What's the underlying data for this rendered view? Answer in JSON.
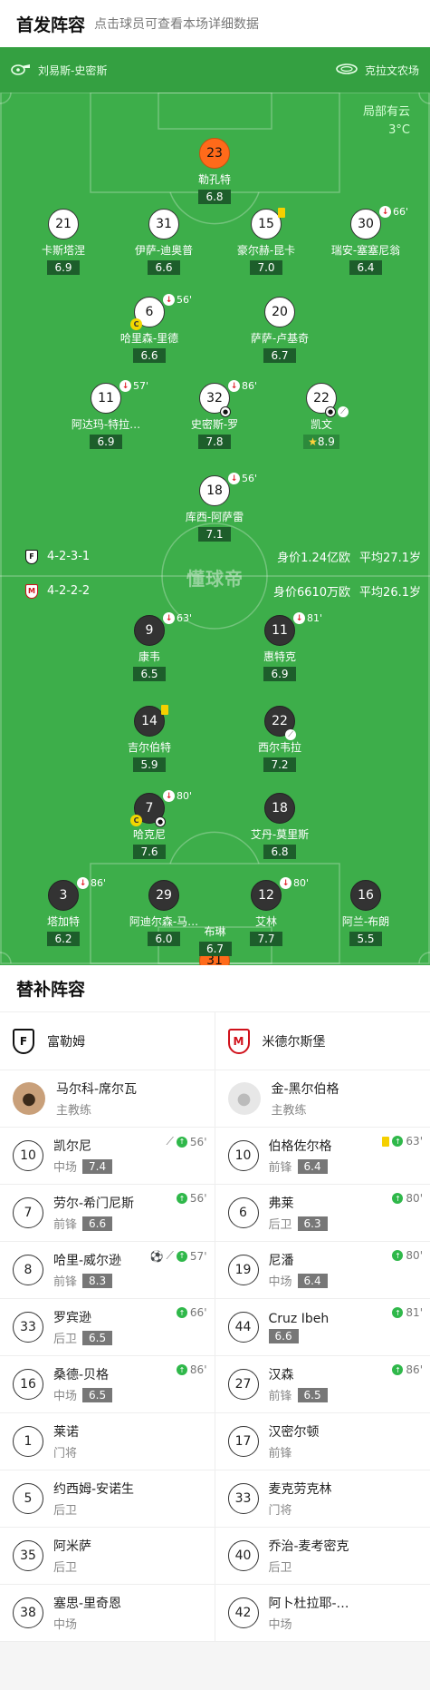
{
  "header": {
    "title": "首发阵容",
    "subtitle": "点击球员可查看本场详细数据"
  },
  "referee": {
    "name": "刘易斯-史密斯"
  },
  "venue": {
    "name": "克拉文农场"
  },
  "weather": {
    "condition": "局部有云",
    "temp": "3°C"
  },
  "home": {
    "formation": "4-2-3-1",
    "value_text": "身价1.24亿欧",
    "age_text": "平均27.1岁",
    "players": [
      {
        "num": "23",
        "name": "勒孔特",
        "rating": "6.8"
      },
      {
        "num": "21",
        "name": "卡斯塔涅",
        "rating": "6.9"
      },
      {
        "num": "31",
        "name": "伊萨-迪奥普",
        "rating": "6.6"
      },
      {
        "num": "15",
        "name": "豪尔赫-昆卡",
        "rating": "7.0"
      },
      {
        "num": "30",
        "name": "瑞安-塞塞尼翁",
        "rating": "6.4",
        "sub": "66'"
      },
      {
        "num": "6",
        "name": "哈里森-里德",
        "rating": "6.6",
        "sub": "56'"
      },
      {
        "num": "20",
        "name": "萨萨-卢基奇",
        "rating": "6.7"
      },
      {
        "num": "11",
        "name": "阿达玛-特拉…",
        "rating": "6.9",
        "sub": "57'"
      },
      {
        "num": "32",
        "name": "史密斯-罗",
        "rating": "7.8",
        "sub": "86'"
      },
      {
        "num": "22",
        "name": "凯文",
        "rating": "8.9"
      },
      {
        "num": "18",
        "name": "库西-阿萨雷",
        "rating": "7.1",
        "sub": "56'"
      }
    ]
  },
  "away": {
    "formation": "4-2-2-2",
    "value_text": "身价6610万欧",
    "age_text": "平均26.1岁",
    "players": [
      {
        "num": "9",
        "name": "康韦",
        "rating": "6.5",
        "sub": "63'"
      },
      {
        "num": "11",
        "name": "惠特克",
        "rating": "6.9",
        "sub": "81'"
      },
      {
        "num": "14",
        "name": "吉尔伯特",
        "rating": "5.9"
      },
      {
        "num": "22",
        "name": "西尔韦拉",
        "rating": "7.2"
      },
      {
        "num": "7",
        "name": "哈克尼",
        "rating": "7.6",
        "sub": "80'"
      },
      {
        "num": "18",
        "name": "艾丹-莫里斯",
        "rating": "6.8"
      },
      {
        "num": "3",
        "name": "塔加特",
        "rating": "6.2",
        "sub": "86'"
      },
      {
        "num": "29",
        "name": "阿迪尔森-马…",
        "rating": "6.0"
      },
      {
        "num": "12",
        "name": "艾林",
        "rating": "7.7",
        "sub": "80'"
      },
      {
        "num": "16",
        "name": "阿兰-布朗",
        "rating": "5.5"
      },
      {
        "num": "31",
        "name": "布琳",
        "rating": "6.7"
      }
    ]
  },
  "watermark": "懂球帝",
  "subs_title": "替补阵容",
  "subs": {
    "home_team": "富勒姆",
    "away_team": "米德尔斯堡",
    "home_coach": {
      "name": "马尔科-席尔瓦",
      "role": "主教练"
    },
    "away_coach": {
      "name": "金-黑尔伯格",
      "role": "主教练"
    },
    "home": [
      {
        "num": "10",
        "name": "凯尔尼",
        "pos": "中场",
        "rating": "7.4",
        "time": "56'"
      },
      {
        "num": "7",
        "name": "劳尔-希门尼斯",
        "pos": "前锋",
        "rating": "6.6",
        "time": "56'"
      },
      {
        "num": "8",
        "name": "哈里-威尔逊",
        "pos": "前锋",
        "rating": "8.3",
        "time": "57'"
      },
      {
        "num": "33",
        "name": "罗宾逊",
        "pos": "后卫",
        "rating": "6.5",
        "time": "66'"
      },
      {
        "num": "16",
        "name": "桑德-贝格",
        "pos": "中场",
        "rating": "6.5",
        "time": "86'"
      },
      {
        "num": "1",
        "name": "莱诺",
        "pos": "门将",
        "rating": "",
        "time": ""
      },
      {
        "num": "5",
        "name": "约西姆-安诺生",
        "pos": "后卫",
        "rating": "",
        "time": ""
      },
      {
        "num": "35",
        "name": "阿米萨",
        "pos": "后卫",
        "rating": "",
        "time": ""
      },
      {
        "num": "38",
        "name": "塞思-里奇恩",
        "pos": "中场",
        "rating": "",
        "time": ""
      }
    ],
    "away": [
      {
        "num": "10",
        "name": "伯格佐尔格",
        "pos": "前锋",
        "rating": "6.4",
        "time": "63'"
      },
      {
        "num": "6",
        "name": "弗莱",
        "pos": "后卫",
        "rating": "6.3",
        "time": "80'"
      },
      {
        "num": "19",
        "name": "尼潘",
        "pos": "中场",
        "rating": "6.4",
        "time": "80'"
      },
      {
        "num": "44",
        "name": "Cruz Ibeh",
        "pos": "",
        "rating": "6.6",
        "time": "81'"
      },
      {
        "num": "27",
        "name": "汉森",
        "pos": "前锋",
        "rating": "6.5",
        "time": "86'"
      },
      {
        "num": "17",
        "name": "汉密尔顿",
        "pos": "前锋",
        "rating": "",
        "time": ""
      },
      {
        "num": "33",
        "name": "麦克劳克林",
        "pos": "门将",
        "rating": "",
        "time": ""
      },
      {
        "num": "40",
        "name": "乔治-麦考密克",
        "pos": "后卫",
        "rating": "",
        "time": ""
      },
      {
        "num": "42",
        "name": "阿卜杜拉耶-…",
        "pos": "中场",
        "rating": "",
        "time": ""
      }
    ]
  },
  "colors": {
    "pitch": "#3dae4a",
    "goalkeeper": "#ff6a1a",
    "sub_green": "#2fb84a",
    "sub_red": "#e0262c"
  }
}
